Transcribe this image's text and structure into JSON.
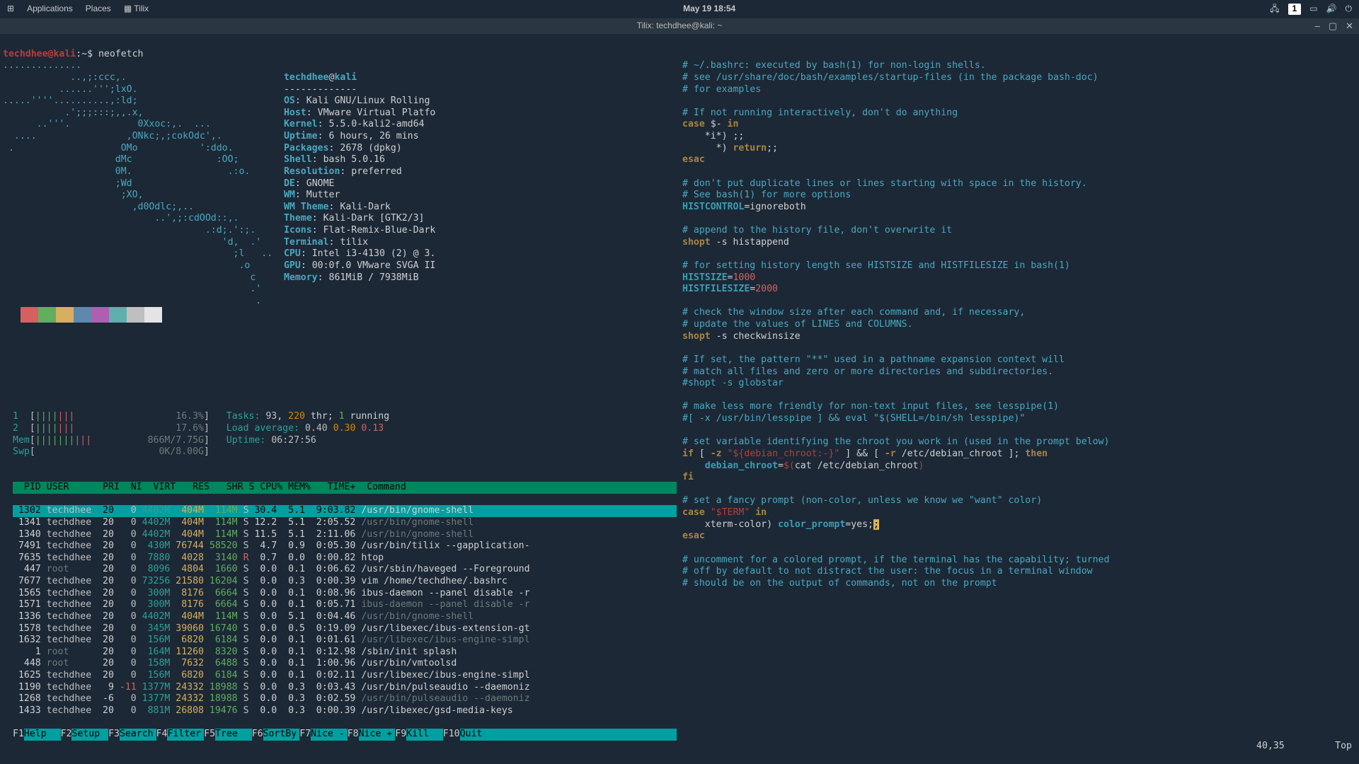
{
  "topbar": {
    "applications": "Applications",
    "places": "Places",
    "app_title": "Tilix",
    "clock": "May 19  18:54",
    "workspace": "1"
  },
  "titlebar": {
    "title": "Tilix: techdhee@kali: ~"
  },
  "prompt": {
    "user": "techdhee@kali",
    "path": ":~$ ",
    "command": "neofetch"
  },
  "ascii": [
    "..............",
    "            ..,;:ccc,.",
    "          ......''';lxO.",
    ".....''''..........,:ld;",
    "           .';;;:::;,,.x,",
    "      ..'''.            0Xxoc:,.  ...",
    "  ....                ,ONkc;,;cokOdc',.",
    " .                   OMo           ':ddo.",
    "                    dMc               :OO;",
    "                    0M.                 .:o.",
    "                    ;Wd",
    "                     ;XO,",
    "                       ,d0Odlc;,..",
    "                           ..',;:cdOOd::,.",
    "                                    .:d;.':;.",
    "                                       'd,  .'",
    "                                         ;l   ..",
    "                                          .o",
    "                                            c",
    "                                            .'",
    "                                             ."
  ],
  "neofetch": {
    "title_user": "techdhee",
    "title_host": "kali",
    "divider": "-------------",
    "OS": "Kali GNU/Linux Rolling",
    "Host": "VMware Virtual Platfo",
    "Kernel": "5.5.0-kali2-amd64",
    "Uptime": "6 hours, 26 mins",
    "Packages": "2678 (dpkg)",
    "Shell": "bash 5.0.16",
    "Resolution": "preferred",
    "DE": "GNOME",
    "WM": "Mutter",
    "WM Theme": "Kali-Dark",
    "Theme": "Kali-Dark [GTK2/3]",
    "Icons": "Flat-Remix-Blue-Dark",
    "Terminal": "tilix",
    "CPU": "Intel i3-4130 (2) @ 3.",
    "GPU": "00:0f.0 VMware SVGA II",
    "Memory": "861MiB / 7938MiB"
  },
  "colors": [
    "#1c2836",
    "#d75f5f",
    "#5faf5f",
    "#d7af5f",
    "#5f87af",
    "#af5faf",
    "#5fafaf",
    "#bfbfbf",
    "#e4e4e4"
  ],
  "htop": {
    "cpu1": {
      "label": "1",
      "bars": "|||||||",
      "pct": "16.3%"
    },
    "cpu2": {
      "label": "2",
      "bars": "|||||||",
      "pct": "17.6%"
    },
    "mem": {
      "label": "Mem",
      "bars": "||||||||||",
      "val": "866M/7.75G"
    },
    "swp": {
      "label": "Swp",
      "bars": "",
      "val": "0K/8.00G"
    },
    "tasks_l": "Tasks: ",
    "tasks_n": "93",
    "tasks_c": ", ",
    "thr_n": "220",
    "thr_t": " thr; ",
    "run_n": "1",
    "run_t": " running",
    "load_l": "Load average: ",
    "load_v": "0.40 0.30 0.13",
    "uptime_l": "Uptime: ",
    "uptime_v": "06:27:56",
    "header": "  PID USER      PRI  NI  VIRT   RES   SHR S CPU% MEM%   TIME+  Command                                 ",
    "rows": [
      {
        "pid": " 1302",
        "user": "techdhee",
        "pri": "20",
        "ni": "0",
        "virt": "4402M",
        "res": "404M",
        "shr": "114M",
        "s": "S",
        "cpu": "30.4",
        "mem": "5.1",
        "time": "9:03.82",
        "cmd": "/usr/bin/gnome-shell",
        "dim": false,
        "sel": true
      },
      {
        "pid": " 1341",
        "user": "techdhee",
        "pri": "20",
        "ni": "0",
        "virt": "4402M",
        "res": "404M",
        "shr": "114M",
        "s": "S",
        "cpu": "12.2",
        "mem": "5.1",
        "time": "2:05.52",
        "cmd": "/usr/bin/gnome-shell",
        "dim": true,
        "sel": false
      },
      {
        "pid": " 1340",
        "user": "techdhee",
        "pri": "20",
        "ni": "0",
        "virt": "4402M",
        "res": "404M",
        "shr": "114M",
        "s": "S",
        "cpu": "11.5",
        "mem": "5.1",
        "time": "2:11.06",
        "cmd": "/usr/bin/gnome-shell",
        "dim": true,
        "sel": false
      },
      {
        "pid": " 7491",
        "user": "techdhee",
        "pri": "20",
        "ni": "0",
        "virt": "430M",
        "res": "76744",
        "shr": "58520",
        "s": "S",
        "cpu": "4.7",
        "mem": "0.9",
        "time": "0:05.30",
        "cmd": "/usr/bin/tilix --gapplication-",
        "dim": false,
        "sel": false
      },
      {
        "pid": " 7635",
        "user": "techdhee",
        "pri": "20",
        "ni": "0",
        "virt": "7880",
        "res": "4028",
        "shr": "3140",
        "s": "R",
        "cpu": "0.7",
        "mem": "0.0",
        "time": "0:00.82",
        "cmd": "htop",
        "dim": false,
        "sel": false
      },
      {
        "pid": "  447",
        "user": "root",
        "pri": "20",
        "ni": "0",
        "virt": "8096",
        "res": "4804",
        "shr": "1660",
        "s": "S",
        "cpu": "0.0",
        "mem": "0.1",
        "time": "0:06.62",
        "cmd": "/usr/sbin/haveged --Foreground",
        "dim": false,
        "sel": false
      },
      {
        "pid": " 7677",
        "user": "techdhee",
        "pri": "20",
        "ni": "0",
        "virt": "73256",
        "res": "21580",
        "shr": "16204",
        "s": "S",
        "cpu": "0.0",
        "mem": "0.3",
        "time": "0:00.39",
        "cmd": "vim /home/techdhee/.bashrc",
        "dim": false,
        "sel": false
      },
      {
        "pid": " 1565",
        "user": "techdhee",
        "pri": "20",
        "ni": "0",
        "virt": "300M",
        "res": "8176",
        "shr": "6664",
        "s": "S",
        "cpu": "0.0",
        "mem": "0.1",
        "time": "0:08.96",
        "cmd": "ibus-daemon --panel disable -r",
        "dim": false,
        "sel": false
      },
      {
        "pid": " 1571",
        "user": "techdhee",
        "pri": "20",
        "ni": "0",
        "virt": "300M",
        "res": "8176",
        "shr": "6664",
        "s": "S",
        "cpu": "0.0",
        "mem": "0.1",
        "time": "0:05.71",
        "cmd": "ibus-daemon --panel disable -r",
        "dim": true,
        "sel": false
      },
      {
        "pid": " 1336",
        "user": "techdhee",
        "pri": "20",
        "ni": "0",
        "virt": "4402M",
        "res": "404M",
        "shr": "114M",
        "s": "S",
        "cpu": "0.0",
        "mem": "5.1",
        "time": "0:04.46",
        "cmd": "/usr/bin/gnome-shell",
        "dim": true,
        "sel": false
      },
      {
        "pid": " 1578",
        "user": "techdhee",
        "pri": "20",
        "ni": "0",
        "virt": "345M",
        "res": "39060",
        "shr": "16740",
        "s": "S",
        "cpu": "0.0",
        "mem": "0.5",
        "time": "0:19.09",
        "cmd": "/usr/libexec/ibus-extension-gt",
        "dim": false,
        "sel": false
      },
      {
        "pid": " 1632",
        "user": "techdhee",
        "pri": "20",
        "ni": "0",
        "virt": "156M",
        "res": "6820",
        "shr": "6184",
        "s": "S",
        "cpu": "0.0",
        "mem": "0.1",
        "time": "0:01.61",
        "cmd": "/usr/libexec/ibus-engine-simpl",
        "dim": true,
        "sel": false
      },
      {
        "pid": "    1",
        "user": "root",
        "pri": "20",
        "ni": "0",
        "virt": "164M",
        "res": "11260",
        "shr": "8320",
        "s": "S",
        "cpu": "0.0",
        "mem": "0.1",
        "time": "0:12.98",
        "cmd": "/sbin/init splash",
        "dim": false,
        "sel": false
      },
      {
        "pid": "  448",
        "user": "root",
        "pri": "20",
        "ni": "0",
        "virt": "158M",
        "res": "7632",
        "shr": "6488",
        "s": "S",
        "cpu": "0.0",
        "mem": "0.1",
        "time": "1:00.96",
        "cmd": "/usr/bin/vmtoolsd",
        "dim": false,
        "sel": false
      },
      {
        "pid": " 1625",
        "user": "techdhee",
        "pri": "20",
        "ni": "0",
        "virt": "156M",
        "res": "6820",
        "shr": "6184",
        "s": "S",
        "cpu": "0.0",
        "mem": "0.1",
        "time": "0:02.11",
        "cmd": "/usr/libexec/ibus-engine-simpl",
        "dim": false,
        "sel": false
      },
      {
        "pid": " 1190",
        "user": "techdhee",
        "pri": "9",
        "ni": "-11",
        "virt": "1377M",
        "res": "24332",
        "shr": "18988",
        "s": "S",
        "cpu": "0.0",
        "mem": "0.3",
        "time": "0:03.43",
        "cmd": "/usr/bin/pulseaudio --daemoniz",
        "dim": false,
        "sel": false
      },
      {
        "pid": " 1268",
        "user": "techdhee",
        "pri": "-6",
        "ni": "0",
        "virt": "1377M",
        "res": "24332",
        "shr": "18988",
        "s": "S",
        "cpu": "0.0",
        "mem": "0.3",
        "time": "0:02.59",
        "cmd": "/usr/bin/pulseaudio --daemoniz",
        "dim": true,
        "sel": false
      },
      {
        "pid": " 1433",
        "user": "techdhee",
        "pri": "20",
        "ni": "0",
        "virt": "881M",
        "res": "26808",
        "shr": "19476",
        "s": "S",
        "cpu": "0.0",
        "mem": "0.3",
        "time": "0:00.39",
        "cmd": "/usr/libexec/gsd-media-keys",
        "dim": false,
        "sel": false
      }
    ],
    "fkeys": [
      {
        "k": "F1",
        "l": "Help  "
      },
      {
        "k": "F2",
        "l": "Setup "
      },
      {
        "k": "F3",
        "l": "Search"
      },
      {
        "k": "F4",
        "l": "Filter"
      },
      {
        "k": "F5",
        "l": "Tree  "
      },
      {
        "k": "F6",
        "l": "SortBy"
      },
      {
        "k": "F7",
        "l": "Nice -"
      },
      {
        "k": "F8",
        "l": "Nice +"
      },
      {
        "k": "F9",
        "l": "Kill  "
      },
      {
        "k": "F10",
        "l": "Quit"
      }
    ]
  },
  "bashrc": {
    "lines": [
      [
        [
          "cm",
          "# ~/.bashrc: executed by bash(1) for non-login shells."
        ]
      ],
      [
        [
          "cm",
          "# see /usr/share/doc/bash/examples/startup-files (in the package bash-doc)"
        ]
      ],
      [
        [
          "cm",
          "# for examples"
        ]
      ],
      [
        [
          "",
          ""
        ]
      ],
      [
        [
          "cm",
          "# If not running interactively, don't do anything"
        ]
      ],
      [
        [
          "kw",
          "case "
        ],
        [
          "",
          "$- "
        ],
        [
          "kw",
          "in"
        ]
      ],
      [
        [
          "",
          "    *i*) ;;"
        ]
      ],
      [
        [
          "",
          "      *) "
        ],
        [
          "kw",
          "return"
        ],
        [
          "",
          ";;"
        ]
      ],
      [
        [
          "kw",
          "esac"
        ]
      ],
      [
        [
          "",
          ""
        ]
      ],
      [
        [
          "cm",
          "# don't put duplicate lines or lines starting with space in the history."
        ]
      ],
      [
        [
          "cm",
          "# See bash(1) for more options"
        ]
      ],
      [
        [
          "var",
          "HISTCONTROL"
        ],
        [
          "",
          "=ignoreboth"
        ]
      ],
      [
        [
          "",
          ""
        ]
      ],
      [
        [
          "cm",
          "# append to the history file, don't overwrite it"
        ]
      ],
      [
        [
          "kw",
          "shopt"
        ],
        [
          "",
          " -s histappend"
        ]
      ],
      [
        [
          "",
          ""
        ]
      ],
      [
        [
          "cm",
          "# for setting history length see HISTSIZE and HISTFILESIZE in bash(1)"
        ]
      ],
      [
        [
          "var",
          "HISTSIZE"
        ],
        [
          "",
          "="
        ],
        [
          "num",
          "1000"
        ]
      ],
      [
        [
          "var",
          "HISTFILESIZE"
        ],
        [
          "",
          "="
        ],
        [
          "num",
          "2000"
        ]
      ],
      [
        [
          "",
          ""
        ]
      ],
      [
        [
          "cm",
          "# check the window size after each command and, if necessary,"
        ]
      ],
      [
        [
          "cm",
          "# update the values of LINES and COLUMNS."
        ]
      ],
      [
        [
          "kw",
          "shopt"
        ],
        [
          "",
          " -s checkwinsize"
        ]
      ],
      [
        [
          "",
          ""
        ]
      ],
      [
        [
          "cm",
          "# If set, the pattern \"**\" used in a pathname expansion context will"
        ]
      ],
      [
        [
          "cm",
          "# match all files and zero or more directories and subdirectories."
        ]
      ],
      [
        [
          "cm",
          "#shopt -s globstar"
        ]
      ],
      [
        [
          "",
          ""
        ]
      ],
      [
        [
          "cm",
          "# make less more friendly for non-text input files, see lesspipe(1)"
        ]
      ],
      [
        [
          "cm",
          "#[ -x /usr/bin/lesspipe ] && eval \"$(SHELL=/bin/sh lesspipe)\""
        ]
      ],
      [
        [
          "",
          ""
        ]
      ],
      [
        [
          "cm",
          "# set variable identifying the chroot you work in (used in the prompt below)"
        ]
      ],
      [
        [
          "kw",
          "if"
        ],
        [
          "",
          " [ "
        ],
        [
          "kw",
          "-z "
        ],
        [
          "str",
          "\"${debian_chroot:-}\" "
        ],
        [
          "",
          "] && [ "
        ],
        [
          "kw",
          "-r "
        ],
        [
          "",
          "/etc/debian_chroot ]; "
        ],
        [
          "kw",
          "then"
        ]
      ],
      [
        [
          "",
          "    "
        ],
        [
          "var",
          "debian_chroot"
        ],
        [
          "",
          "="
        ],
        [
          "str",
          "$("
        ],
        [
          "",
          "cat /etc/debian_chroot"
        ],
        [
          "str",
          ")"
        ]
      ],
      [
        [
          "kw",
          "fi"
        ]
      ],
      [
        [
          "",
          ""
        ]
      ],
      [
        [
          "cm",
          "# set a fancy prompt (non-color, unless we know we \"want\" color)"
        ]
      ],
      [
        [
          "kw",
          "case "
        ],
        [
          "str",
          "\"$TERM\""
        ],
        [
          "",
          " "
        ],
        [
          "kw",
          "in"
        ]
      ],
      [
        [
          "",
          "    xterm-color) "
        ],
        [
          "var",
          "color_prompt"
        ],
        [
          "",
          "=yes;"
        ],
        [
          "cur",
          ";"
        ]
      ],
      [
        [
          "kw",
          "esac"
        ]
      ],
      [
        [
          "",
          ""
        ]
      ],
      [
        [
          "cm",
          "# uncomment for a colored prompt, if the terminal has the capability; turned"
        ]
      ],
      [
        [
          "cm",
          "# off by default to not distract the user: the focus in a terminal window"
        ]
      ],
      [
        [
          "cm",
          "# should be on the output of commands, not on the prompt"
        ]
      ]
    ],
    "status_pos": "40,35",
    "status_top": "Top"
  }
}
